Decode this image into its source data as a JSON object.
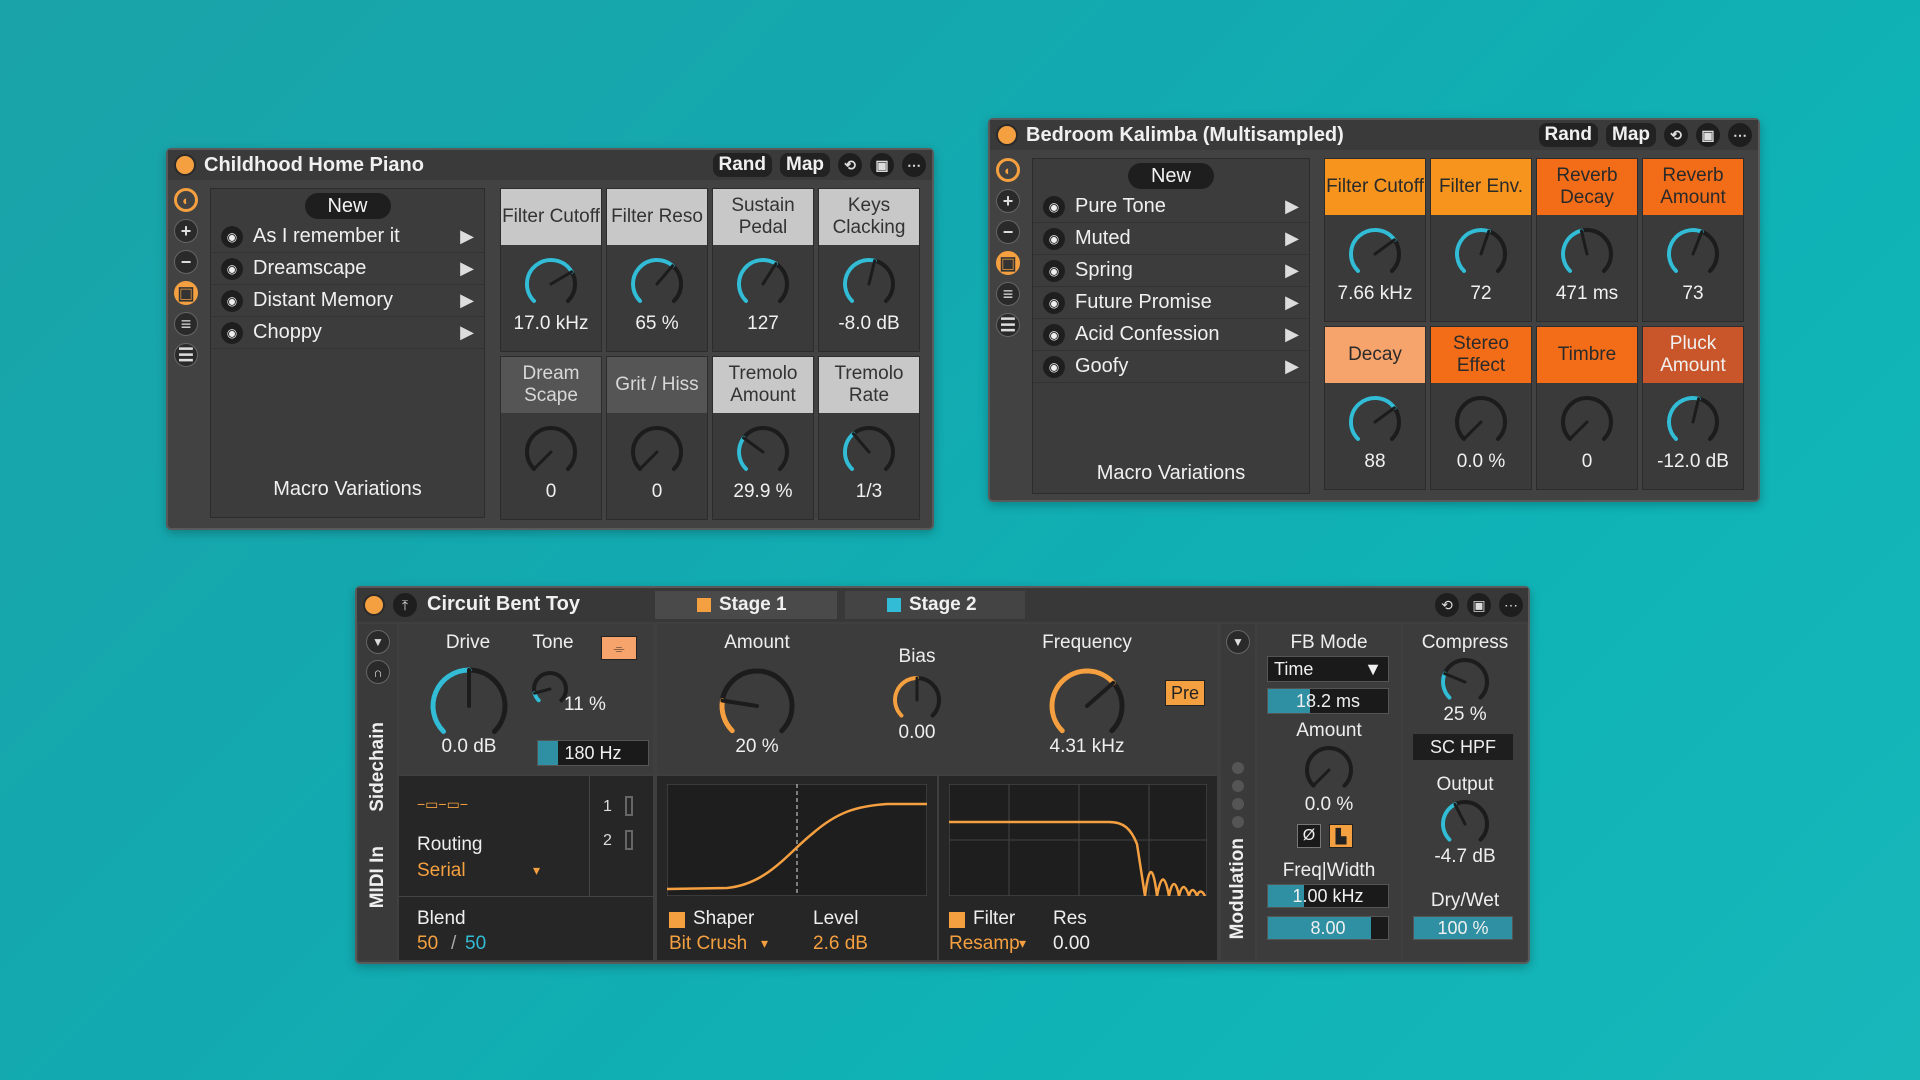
{
  "piano": {
    "title": "Childhood Home Piano",
    "rand": "Rand",
    "map": "Map",
    "new": "New",
    "variations": [
      {
        "label": "As I remember it",
        "arrow": "▶"
      },
      {
        "label": "Dreamscape",
        "arrow": "▶"
      },
      {
        "label": "Distant Memory",
        "arrow": "▶"
      },
      {
        "label": "Choppy",
        "arrow": "▶"
      }
    ],
    "footer": "Macro Variations",
    "macros": [
      {
        "label": "Filter Cutoff",
        "value": "17.0 kHz",
        "level": 0.72
      },
      {
        "label": "Filter Reso",
        "value": "65 %",
        "level": 0.65
      },
      {
        "label": "Sustain Pedal",
        "value": "127",
        "level": 0.62
      },
      {
        "label": "Keys Clacking",
        "value": "-8.0 dB",
        "level": 0.55
      },
      {
        "label": "Dream Scape",
        "value": "0",
        "level": 0
      },
      {
        "label": "Grit / Hiss",
        "value": "0",
        "level": 0
      },
      {
        "label": "Tremolo Amount",
        "value": "29.9 %",
        "level": 0.3
      },
      {
        "label": "Tremolo Rate",
        "value": "1/3",
        "level": 0.35
      }
    ]
  },
  "kalimba": {
    "title": "Bedroom Kalimba (Multisampled)",
    "rand": "Rand",
    "map": "Map",
    "new": "New",
    "variations": [
      {
        "label": "Pure Tone",
        "arrow": "▶"
      },
      {
        "label": "Muted",
        "arrow": "▶"
      },
      {
        "label": "Spring",
        "arrow": "▶"
      },
      {
        "label": "Future Promise",
        "arrow": "▶"
      },
      {
        "label": "Acid Confession",
        "arrow": "▶"
      },
      {
        "label": "Goofy",
        "arrow": "▶"
      }
    ],
    "footer": "Macro Variations",
    "macros": [
      {
        "label": "Filter Cutoff",
        "value": "7.66 kHz",
        "level": 0.7
      },
      {
        "label": "Filter Env.",
        "value": "72",
        "level": 0.57
      },
      {
        "label": "Reverb Decay",
        "value": "471 ms",
        "level": 0.45
      },
      {
        "label": "Reverb Amount",
        "value": "73",
        "level": 0.58
      },
      {
        "label": "Decay",
        "value": "88",
        "level": 0.7
      },
      {
        "label": "Stereo Effect",
        "value": "0.0 %",
        "level": 0
      },
      {
        "label": "Timbre",
        "value": "0",
        "level": 0
      },
      {
        "label": "Pluck Amount",
        "value": "-12.0 dB",
        "level": 0.55
      }
    ]
  },
  "toy": {
    "title": "Circuit Bent Toy",
    "tab1": "Stage 1",
    "tab2": "Stage 2",
    "sidechain": "Sidechain",
    "midi_in": "MIDI In",
    "drive_label": "Drive",
    "drive_value": "0.0 dB",
    "tone_label": "Tone",
    "tone_value": "11 %",
    "hpf_value": "180 Hz",
    "routing_label": "Routing",
    "routing_value": "Serial",
    "route_1": "1",
    "route_2": "2",
    "blend_label": "Blend",
    "blend_a": "50",
    "blend_sep": "/",
    "blend_b": "50",
    "amount_label": "Amount",
    "amount_value": "20 %",
    "bias_label": "Bias",
    "bias_value": "0.00",
    "freq_label": "Frequency",
    "freq_value": "4.31 kHz",
    "pre_label": "Pre",
    "shaper_label": "Shaper",
    "shaper_value": "Bit Crush",
    "level_label": "Level",
    "level_value": "2.6 dB",
    "filter_label": "Filter",
    "filter_value": "Resamp",
    "res_label": "Res",
    "res_value": "0.00",
    "modulation": "Modulation",
    "fb_mode_label": "FB Mode",
    "fb_mode_value": "Time",
    "fb_time": "18.2 ms",
    "fb_amount_label": "Amount",
    "fb_amount_value": "0.0 %",
    "phase_label": "Ø",
    "freq_width_label": "Freq|Width",
    "freq_width_value": "1.00 kHz",
    "width_value": "8.00",
    "compress_label": "Compress",
    "compress_value": "25 %",
    "sc_hpf": "SC HPF",
    "output_label": "Output",
    "output_value": "-4.7 dB",
    "drywet_label": "Dry/Wet",
    "drywet_value": "100 %"
  },
  "colors": {
    "accent_orange": "#f5a040",
    "accent_teal": "#33bcd6",
    "panel": "#424242"
  }
}
